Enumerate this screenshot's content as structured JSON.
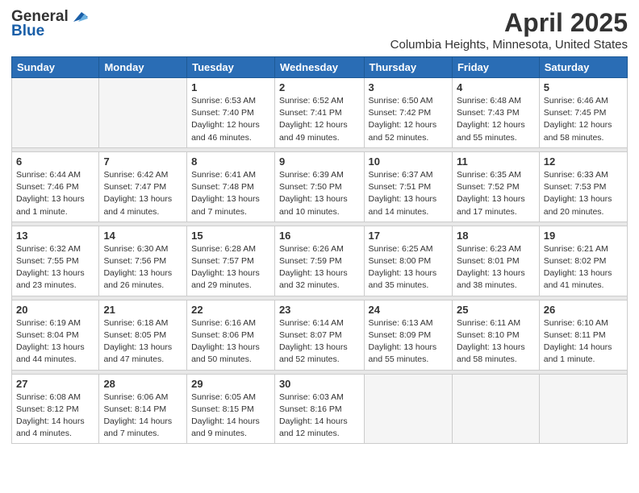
{
  "header": {
    "logo_general": "General",
    "logo_blue": "Blue",
    "month": "April 2025",
    "location": "Columbia Heights, Minnesota, United States"
  },
  "days_of_week": [
    "Sunday",
    "Monday",
    "Tuesday",
    "Wednesday",
    "Thursday",
    "Friday",
    "Saturday"
  ],
  "weeks": [
    [
      {
        "day": "",
        "sunrise": "",
        "sunset": "",
        "daylight": ""
      },
      {
        "day": "",
        "sunrise": "",
        "sunset": "",
        "daylight": ""
      },
      {
        "day": "1",
        "sunrise": "Sunrise: 6:53 AM",
        "sunset": "Sunset: 7:40 PM",
        "daylight": "Daylight: 12 hours and 46 minutes."
      },
      {
        "day": "2",
        "sunrise": "Sunrise: 6:52 AM",
        "sunset": "Sunset: 7:41 PM",
        "daylight": "Daylight: 12 hours and 49 minutes."
      },
      {
        "day": "3",
        "sunrise": "Sunrise: 6:50 AM",
        "sunset": "Sunset: 7:42 PM",
        "daylight": "Daylight: 12 hours and 52 minutes."
      },
      {
        "day": "4",
        "sunrise": "Sunrise: 6:48 AM",
        "sunset": "Sunset: 7:43 PM",
        "daylight": "Daylight: 12 hours and 55 minutes."
      },
      {
        "day": "5",
        "sunrise": "Sunrise: 6:46 AM",
        "sunset": "Sunset: 7:45 PM",
        "daylight": "Daylight: 12 hours and 58 minutes."
      }
    ],
    [
      {
        "day": "6",
        "sunrise": "Sunrise: 6:44 AM",
        "sunset": "Sunset: 7:46 PM",
        "daylight": "Daylight: 13 hours and 1 minute."
      },
      {
        "day": "7",
        "sunrise": "Sunrise: 6:42 AM",
        "sunset": "Sunset: 7:47 PM",
        "daylight": "Daylight: 13 hours and 4 minutes."
      },
      {
        "day": "8",
        "sunrise": "Sunrise: 6:41 AM",
        "sunset": "Sunset: 7:48 PM",
        "daylight": "Daylight: 13 hours and 7 minutes."
      },
      {
        "day": "9",
        "sunrise": "Sunrise: 6:39 AM",
        "sunset": "Sunset: 7:50 PM",
        "daylight": "Daylight: 13 hours and 10 minutes."
      },
      {
        "day": "10",
        "sunrise": "Sunrise: 6:37 AM",
        "sunset": "Sunset: 7:51 PM",
        "daylight": "Daylight: 13 hours and 14 minutes."
      },
      {
        "day": "11",
        "sunrise": "Sunrise: 6:35 AM",
        "sunset": "Sunset: 7:52 PM",
        "daylight": "Daylight: 13 hours and 17 minutes."
      },
      {
        "day": "12",
        "sunrise": "Sunrise: 6:33 AM",
        "sunset": "Sunset: 7:53 PM",
        "daylight": "Daylight: 13 hours and 20 minutes."
      }
    ],
    [
      {
        "day": "13",
        "sunrise": "Sunrise: 6:32 AM",
        "sunset": "Sunset: 7:55 PM",
        "daylight": "Daylight: 13 hours and 23 minutes."
      },
      {
        "day": "14",
        "sunrise": "Sunrise: 6:30 AM",
        "sunset": "Sunset: 7:56 PM",
        "daylight": "Daylight: 13 hours and 26 minutes."
      },
      {
        "day": "15",
        "sunrise": "Sunrise: 6:28 AM",
        "sunset": "Sunset: 7:57 PM",
        "daylight": "Daylight: 13 hours and 29 minutes."
      },
      {
        "day": "16",
        "sunrise": "Sunrise: 6:26 AM",
        "sunset": "Sunset: 7:59 PM",
        "daylight": "Daylight: 13 hours and 32 minutes."
      },
      {
        "day": "17",
        "sunrise": "Sunrise: 6:25 AM",
        "sunset": "Sunset: 8:00 PM",
        "daylight": "Daylight: 13 hours and 35 minutes."
      },
      {
        "day": "18",
        "sunrise": "Sunrise: 6:23 AM",
        "sunset": "Sunset: 8:01 PM",
        "daylight": "Daylight: 13 hours and 38 minutes."
      },
      {
        "day": "19",
        "sunrise": "Sunrise: 6:21 AM",
        "sunset": "Sunset: 8:02 PM",
        "daylight": "Daylight: 13 hours and 41 minutes."
      }
    ],
    [
      {
        "day": "20",
        "sunrise": "Sunrise: 6:19 AM",
        "sunset": "Sunset: 8:04 PM",
        "daylight": "Daylight: 13 hours and 44 minutes."
      },
      {
        "day": "21",
        "sunrise": "Sunrise: 6:18 AM",
        "sunset": "Sunset: 8:05 PM",
        "daylight": "Daylight: 13 hours and 47 minutes."
      },
      {
        "day": "22",
        "sunrise": "Sunrise: 6:16 AM",
        "sunset": "Sunset: 8:06 PM",
        "daylight": "Daylight: 13 hours and 50 minutes."
      },
      {
        "day": "23",
        "sunrise": "Sunrise: 6:14 AM",
        "sunset": "Sunset: 8:07 PM",
        "daylight": "Daylight: 13 hours and 52 minutes."
      },
      {
        "day": "24",
        "sunrise": "Sunrise: 6:13 AM",
        "sunset": "Sunset: 8:09 PM",
        "daylight": "Daylight: 13 hours and 55 minutes."
      },
      {
        "day": "25",
        "sunrise": "Sunrise: 6:11 AM",
        "sunset": "Sunset: 8:10 PM",
        "daylight": "Daylight: 13 hours and 58 minutes."
      },
      {
        "day": "26",
        "sunrise": "Sunrise: 6:10 AM",
        "sunset": "Sunset: 8:11 PM",
        "daylight": "Daylight: 14 hours and 1 minute."
      }
    ],
    [
      {
        "day": "27",
        "sunrise": "Sunrise: 6:08 AM",
        "sunset": "Sunset: 8:12 PM",
        "daylight": "Daylight: 14 hours and 4 minutes."
      },
      {
        "day": "28",
        "sunrise": "Sunrise: 6:06 AM",
        "sunset": "Sunset: 8:14 PM",
        "daylight": "Daylight: 14 hours and 7 minutes."
      },
      {
        "day": "29",
        "sunrise": "Sunrise: 6:05 AM",
        "sunset": "Sunset: 8:15 PM",
        "daylight": "Daylight: 14 hours and 9 minutes."
      },
      {
        "day": "30",
        "sunrise": "Sunrise: 6:03 AM",
        "sunset": "Sunset: 8:16 PM",
        "daylight": "Daylight: 14 hours and 12 minutes."
      },
      {
        "day": "",
        "sunrise": "",
        "sunset": "",
        "daylight": ""
      },
      {
        "day": "",
        "sunrise": "",
        "sunset": "",
        "daylight": ""
      },
      {
        "day": "",
        "sunrise": "",
        "sunset": "",
        "daylight": ""
      }
    ]
  ]
}
